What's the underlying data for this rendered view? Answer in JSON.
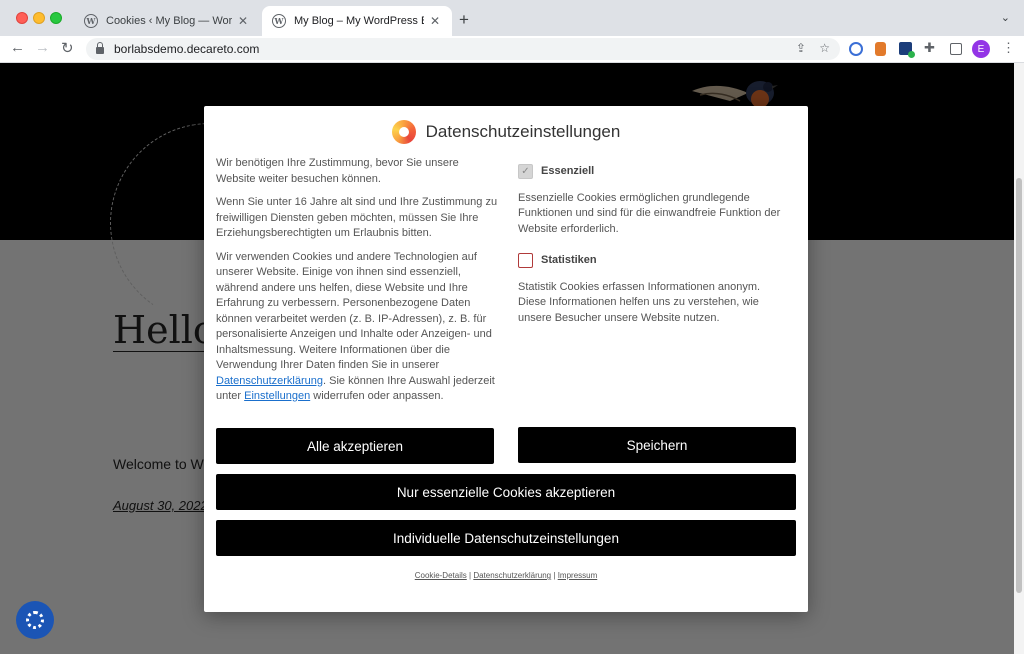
{
  "browser": {
    "tabs": [
      {
        "title": "Cookies ‹ My Blog — WordPress",
        "close": "✕",
        "favicon": "wordpress-icon"
      },
      {
        "title": "My Blog – My WordPress Blog",
        "close": "✕",
        "favicon": "wordpress-icon"
      }
    ],
    "new_tab": "+",
    "tab_menu": "⌄",
    "url": "borlabsdemo.decareto.com",
    "profile_initial": "E"
  },
  "page": {
    "title": "Hello",
    "body": "Welcome to W",
    "date": "August 30, 2022"
  },
  "dialog": {
    "title": "Datenschutzeinstellungen",
    "intro_1": "Wir benötigen Ihre Zustimmung, bevor Sie unsere Website weiter besuchen können.",
    "intro_2": "Wenn Sie unter 16 Jahre alt sind und Ihre Zustimmung zu freiwilligen Diensten geben möchten, müssen Sie Ihre Erziehungsberechtigten um Erlaubnis bitten.",
    "intro_3_a": "Wir verwenden Cookies und andere Technologien auf unserer Website. Einige von ihnen sind essenziell, während andere uns helfen, diese Website und Ihre Erfahrung zu verbessern. Personenbezogene Daten können verarbeitet werden (z. B. IP-Adressen), z. B. für personalisierte Anzeigen und Inhalte oder Anzeigen- und Inhaltsmessung. Weitere Informationen über die Verwendung Ihrer Daten finden Sie in unserer",
    "privacy_link": "Datenschutzerklärung",
    "intro_3_b": ". Sie können Ihre Auswahl jederzeit unter",
    "settings_link": "Einstellungen",
    "intro_3_c": "widerrufen oder anpassen.",
    "categories": [
      {
        "label": "Essenziell",
        "checked": true,
        "description": "Essenzielle Cookies ermöglichen grundlegende Funktionen und sind für die einwandfreie Funktion der Website erforderlich."
      },
      {
        "label": "Statistiken",
        "checked": false,
        "description": "Statistik Cookies erfassen Informationen anonym. Diese Informationen helfen uns zu verstehen, wie unsere Besucher unsere Website nutzen."
      }
    ],
    "buttons": {
      "accept_all": "Alle akzeptieren",
      "save": "Speichern",
      "essential_only": "Nur essenzielle Cookies akzeptieren",
      "individual": "Individuelle Datenschutzeinstellungen"
    },
    "footer": {
      "cookie_details": "Cookie-Details",
      "privacy": "Datenschutzerklärung",
      "imprint": "Impressum",
      "separator": "|"
    }
  },
  "colors": {
    "button_bg": "#000000",
    "link": "#1a6fcc",
    "unchecked_border": "#b03a3a"
  }
}
